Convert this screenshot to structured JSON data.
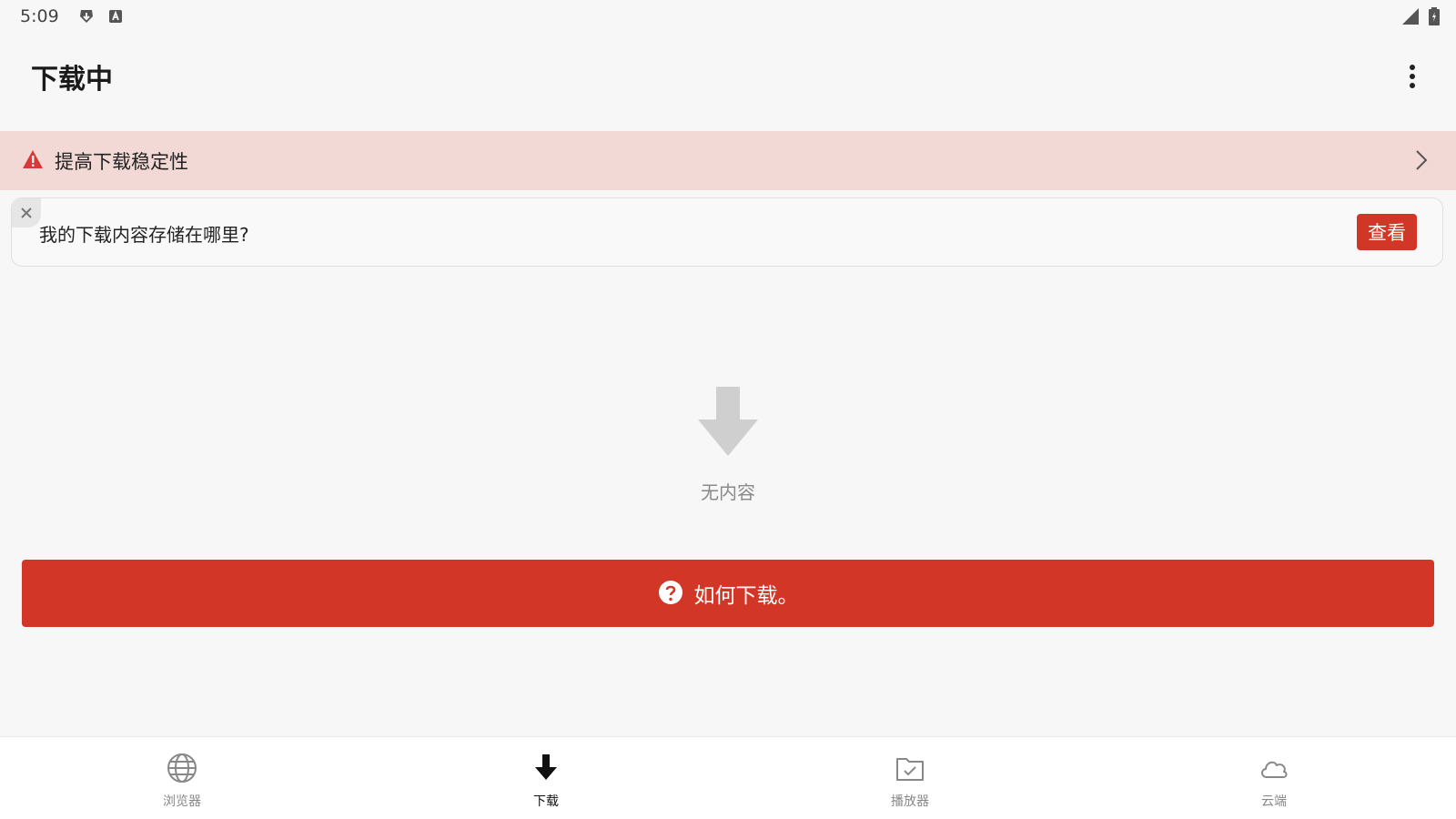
{
  "status_bar": {
    "time": "5:09",
    "icons_left": [
      "download-badge-icon",
      "keyboard-a-icon"
    ],
    "icons_right": [
      "signal-icon",
      "battery-icon"
    ]
  },
  "app_bar": {
    "title": "下载中",
    "menu_icon": "more-vert-icon"
  },
  "warning_banner": {
    "text": "提高下载稳定性",
    "icon": "warning-icon",
    "color": "#f2d9d6",
    "icon_color": "#d63a3a"
  },
  "info_card": {
    "text": "我的下载内容存储在哪里?",
    "button_label": "查看",
    "close_icon": "close-icon"
  },
  "empty_state": {
    "icon": "download-arrow-icon",
    "text": "无内容"
  },
  "how_to_button": {
    "label": "如何下载。",
    "icon": "help-circle-icon",
    "color": "#d23626"
  },
  "bottom_nav": {
    "items": [
      {
        "label": "浏览器",
        "icon": "globe-icon",
        "active": false
      },
      {
        "label": "下载",
        "icon": "download-icon",
        "active": true
      },
      {
        "label": "播放器",
        "icon": "folder-check-icon",
        "active": false
      },
      {
        "label": "云端",
        "icon": "cloud-icon",
        "active": false
      }
    ]
  },
  "colors": {
    "accent": "#d23626",
    "background": "#f7f7f7"
  }
}
